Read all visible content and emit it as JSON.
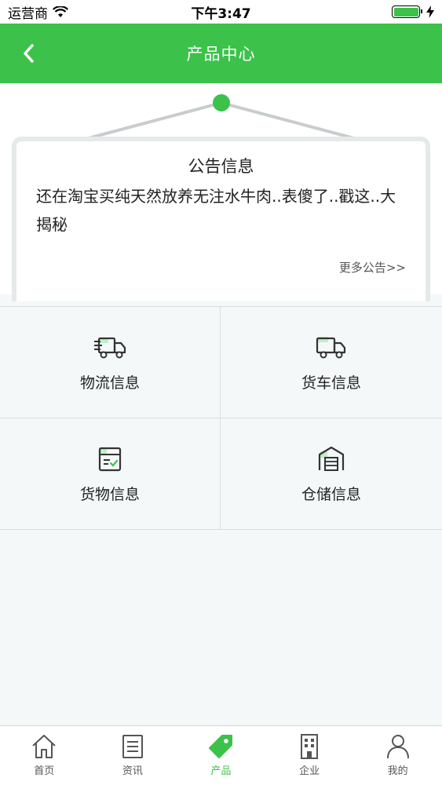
{
  "status_bar": {
    "carrier": "运营商",
    "time": "下午3:47"
  },
  "header": {
    "title": "产品中心",
    "back_icon": "chevron-left-icon"
  },
  "notice": {
    "title": "公告信息",
    "text": "还在淘宝买纯天然放养无注水牛肉..表傻了..戳这..大揭秘",
    "more_label": "更多公告>>"
  },
  "grid": [
    {
      "label": "物流信息",
      "icon": "logistics-truck-icon"
    },
    {
      "label": "货车信息",
      "icon": "truck-icon"
    },
    {
      "label": "货物信息",
      "icon": "cargo-box-icon"
    },
    {
      "label": "仓储信息",
      "icon": "warehouse-icon"
    }
  ],
  "tabbar": {
    "active_color": "#3cc24a",
    "items": [
      {
        "label": "首页",
        "icon": "home-icon"
      },
      {
        "label": "资讯",
        "icon": "news-icon"
      },
      {
        "label": "产品",
        "icon": "tag-icon"
      },
      {
        "label": "企业",
        "icon": "building-icon"
      },
      {
        "label": "我的",
        "icon": "user-icon"
      }
    ]
  },
  "colors": {
    "brand": "#3cc24a",
    "background": "#f4f8f8"
  }
}
